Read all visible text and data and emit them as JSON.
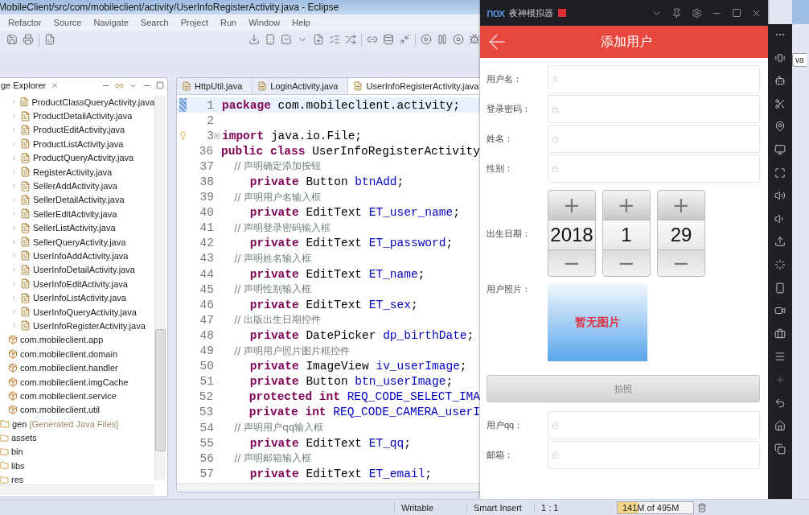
{
  "eclipse": {
    "title": "MobileClient/src/com/mobileclient/activity/UserInfoRegisterActivity.java - Eclipse",
    "menu": [
      "Refactor",
      "Source",
      "Navigate",
      "Search",
      "Project",
      "Run",
      "Window",
      "Help"
    ],
    "explorer": {
      "tab": "ge Explorer",
      "tree": [
        {
          "kind": "group",
          "children": [
            {
              "kind": "file",
              "label": "ProductClassQueryActivity.java"
            },
            {
              "kind": "file",
              "label": "ProductDetailActivity.java"
            },
            {
              "kind": "file",
              "label": "ProductEditActivity.java"
            },
            {
              "kind": "file",
              "label": "ProductListActivity.java"
            },
            {
              "kind": "file",
              "label": "ProductQueryActivity.java"
            },
            {
              "kind": "file",
              "label": "RegisterActivity.java"
            },
            {
              "kind": "file",
              "label": "SellerAddActivity.java"
            },
            {
              "kind": "file",
              "label": "SellerDetailActivity.java"
            },
            {
              "kind": "file",
              "label": "SellerEditActivity.java"
            },
            {
              "kind": "file",
              "label": "SellerListActivity.java"
            },
            {
              "kind": "file",
              "label": "SellerQueryActivity.java"
            },
            {
              "kind": "file",
              "label": "UserInfoAddActivity.java"
            },
            {
              "kind": "file",
              "label": "UserInfoDetailActivity.java"
            },
            {
              "kind": "file",
              "label": "UserInfoEditActivity.java"
            },
            {
              "kind": "file",
              "label": "UserInfoListActivity.java"
            },
            {
              "kind": "file",
              "label": "UserInfoQueryActivity.java"
            },
            {
              "kind": "file",
              "label": "UserInfoRegisterActivity.java"
            }
          ]
        },
        {
          "kind": "package",
          "label": "com.mobileclient.app"
        },
        {
          "kind": "package",
          "label": "com.mobileclient.domain"
        },
        {
          "kind": "package",
          "label": "com.mobileclient.handler"
        },
        {
          "kind": "package",
          "label": "com.mobileclient.imgCache"
        },
        {
          "kind": "package",
          "label": "com.mobileclient.service"
        },
        {
          "kind": "package",
          "label": "com.mobileclient.util"
        },
        {
          "kind": "source",
          "label": "gen",
          "note": "[Generated Java Files]"
        },
        {
          "kind": "folder",
          "label": "assets"
        },
        {
          "kind": "folder",
          "label": "bin"
        },
        {
          "kind": "folder",
          "label": "libs"
        },
        {
          "kind": "folder",
          "label": "res"
        }
      ]
    },
    "editor": {
      "tabs": [
        {
          "label": "HttpUtil.java",
          "selected": false
        },
        {
          "label": "LoginActivity.java",
          "selected": false
        },
        {
          "label": "UserInfoRegisterActivity.java",
          "selected": true
        }
      ],
      "lines": [
        {
          "number": "1",
          "current": true,
          "folded": false,
          "warning": false,
          "segments": [
            {
              "kind": "keyword",
              "text": "package"
            },
            {
              "kind": "plain",
              "text": " com.mobileclient.activity;"
            }
          ]
        },
        {
          "number": "2",
          "current": false,
          "folded": false,
          "warning": false
        },
        {
          "number": "3",
          "current": false,
          "folded": true,
          "warning": true,
          "segments": [
            {
              "kind": "keyword",
              "text": "import"
            },
            {
              "kind": "plain",
              "text": " java.io.File;"
            }
          ]
        },
        {
          "number": "36",
          "current": false,
          "folded": false,
          "warning": false,
          "segments": [
            {
              "kind": "keyword",
              "text": "public class"
            },
            {
              "kind": "plain",
              "text": " UserInfoRegisterActivity"
            }
          ]
        },
        {
          "number": "37",
          "current": false,
          "folded": false,
          "warning": false,
          "segments": [
            {
              "kind": "comment",
              "text": "    // 声明确定添加按钮"
            }
          ]
        },
        {
          "number": "38",
          "current": false,
          "folded": false,
          "warning": false,
          "segments": [
            {
              "kind": "keyword",
              "text": "    private"
            },
            {
              "kind": "plain",
              "text": " Button "
            },
            {
              "kind": "field",
              "text": "btnAdd"
            },
            {
              "kind": "plain",
              "text": ";"
            }
          ]
        },
        {
          "number": "39",
          "current": false,
          "folded": false,
          "warning": false,
          "segments": [
            {
              "kind": "comment",
              "text": "    // 声明用户名输入框"
            }
          ]
        },
        {
          "number": "40",
          "current": false,
          "folded": false,
          "warning": false,
          "segments": [
            {
              "kind": "keyword",
              "text": "    private"
            },
            {
              "kind": "plain",
              "text": " EditText "
            },
            {
              "kind": "field",
              "text": "ET_user_name"
            },
            {
              "kind": "plain",
              "text": ";"
            }
          ]
        },
        {
          "number": "41",
          "current": false,
          "folded": false,
          "warning": false,
          "segments": [
            {
              "kind": "comment",
              "text": "    // 声明登录密码输入框"
            }
          ]
        },
        {
          "number": "42",
          "current": false,
          "folded": false,
          "warning": false,
          "segments": [
            {
              "kind": "keyword",
              "text": "    private"
            },
            {
              "kind": "plain",
              "text": " EditText "
            },
            {
              "kind": "field",
              "text": "ET_password"
            },
            {
              "kind": "plain",
              "text": ";"
            }
          ]
        },
        {
          "number": "43",
          "current": false,
          "folded": false,
          "warning": false,
          "segments": [
            {
              "kind": "comment",
              "text": "    // 声明姓名输入框"
            }
          ]
        },
        {
          "number": "44",
          "current": false,
          "folded": false,
          "warning": false,
          "segments": [
            {
              "kind": "keyword",
              "text": "    private"
            },
            {
              "kind": "plain",
              "text": " EditText "
            },
            {
              "kind": "field",
              "text": "ET_name"
            },
            {
              "kind": "plain",
              "text": ";"
            }
          ]
        },
        {
          "number": "45",
          "current": false,
          "folded": false,
          "warning": false,
          "segments": [
            {
              "kind": "comment",
              "text": "    // 声明性别输入框"
            }
          ]
        },
        {
          "number": "46",
          "current": false,
          "folded": false,
          "warning": false,
          "segments": [
            {
              "kind": "keyword",
              "text": "    private"
            },
            {
              "kind": "plain",
              "text": " EditText "
            },
            {
              "kind": "field",
              "text": "ET_sex"
            },
            {
              "kind": "plain",
              "text": ";"
            }
          ]
        },
        {
          "number": "47",
          "current": false,
          "folded": false,
          "warning": false,
          "segments": [
            {
              "kind": "comment",
              "text": "    // 出版出生日期控件"
            }
          ]
        },
        {
          "number": "48",
          "current": false,
          "folded": false,
          "warning": false,
          "segments": [
            {
              "kind": "keyword",
              "text": "    private"
            },
            {
              "kind": "plain",
              "text": " DatePicker "
            },
            {
              "kind": "field",
              "text": "dp_birthDate"
            },
            {
              "kind": "plain",
              "text": ";"
            }
          ]
        },
        {
          "number": "49",
          "current": false,
          "folded": false,
          "warning": false,
          "segments": [
            {
              "kind": "comment",
              "text": "    // 声明用户照片图片框控件"
            }
          ]
        },
        {
          "number": "50",
          "current": false,
          "folded": false,
          "warning": false,
          "segments": [
            {
              "kind": "keyword",
              "text": "    private"
            },
            {
              "kind": "plain",
              "text": " ImageView "
            },
            {
              "kind": "field",
              "text": "iv_userImage"
            },
            {
              "kind": "plain",
              "text": ";"
            }
          ]
        },
        {
          "number": "51",
          "current": false,
          "folded": false,
          "warning": false,
          "segments": [
            {
              "kind": "keyword",
              "text": "    private"
            },
            {
              "kind": "plain",
              "text": " Button "
            },
            {
              "kind": "field",
              "text": "btn_userImage"
            },
            {
              "kind": "plain",
              "text": ";"
            }
          ]
        },
        {
          "number": "52",
          "current": false,
          "folded": false,
          "warning": false,
          "segments": [
            {
              "kind": "keyword",
              "text": "    protected int"
            },
            {
              "kind": "field",
              "text": " REQ_CODE_SELECT_IMA"
            }
          ]
        },
        {
          "number": "53",
          "current": false,
          "folded": false,
          "warning": false,
          "segments": [
            {
              "kind": "keyword",
              "text": "    private int"
            },
            {
              "kind": "field",
              "text": " REQ_CODE_CAMERA_userI"
            }
          ]
        },
        {
          "number": "54",
          "current": false,
          "folded": false,
          "warning": false,
          "segments": [
            {
              "kind": "comment",
              "text": "    // 声明用户qq输入框"
            }
          ]
        },
        {
          "number": "55",
          "current": false,
          "folded": false,
          "warning": false,
          "segments": [
            {
              "kind": "keyword",
              "text": "    private"
            },
            {
              "kind": "plain",
              "text": " EditText "
            },
            {
              "kind": "field",
              "text": "ET_qq"
            },
            {
              "kind": "plain",
              "text": ";"
            }
          ]
        },
        {
          "number": "56",
          "current": false,
          "folded": false,
          "warning": false,
          "segments": [
            {
              "kind": "comment",
              "text": "    // 声明邮箱输入框"
            }
          ]
        },
        {
          "number": "57",
          "current": false,
          "folded": false,
          "warning": false,
          "segments": [
            {
              "kind": "keyword",
              "text": "    private"
            },
            {
              "kind": "plain",
              "text": " EditText "
            },
            {
              "kind": "field",
              "text": "ET_email"
            },
            {
              "kind": "plain",
              "text": ";"
            }
          ]
        }
      ]
    },
    "status_bar": {
      "mode": "Writable",
      "insert": "Smart Insert",
      "position": "1 : 1",
      "memory": {
        "text": "141M of 495M",
        "level": 0.28
      }
    },
    "side_tab": "va"
  },
  "emulator": {
    "logo": "nox",
    "name": "夜神模拟器",
    "app": {
      "title": "添加用户",
      "fields": [
        {
          "label": "用户名："
        },
        {
          "label": "登录密码："
        },
        {
          "label": "姓名："
        },
        {
          "label": "性别："
        }
      ],
      "birth": {
        "label": "出生日期：",
        "columns": [
          {
            "plus": "+",
            "value": "2018",
            "minus": "−"
          },
          {
            "plus": "+",
            "value": "1",
            "minus": "−"
          },
          {
            "plus": "+",
            "value": "29",
            "minus": "−"
          }
        ]
      },
      "photo": {
        "label": "用户照片：",
        "placeholder": "暂无图片"
      },
      "photo_button": "拍照",
      "more_fields": [
        {
          "label": "用户qq："
        },
        {
          "label": "邮箱："
        }
      ]
    }
  }
}
